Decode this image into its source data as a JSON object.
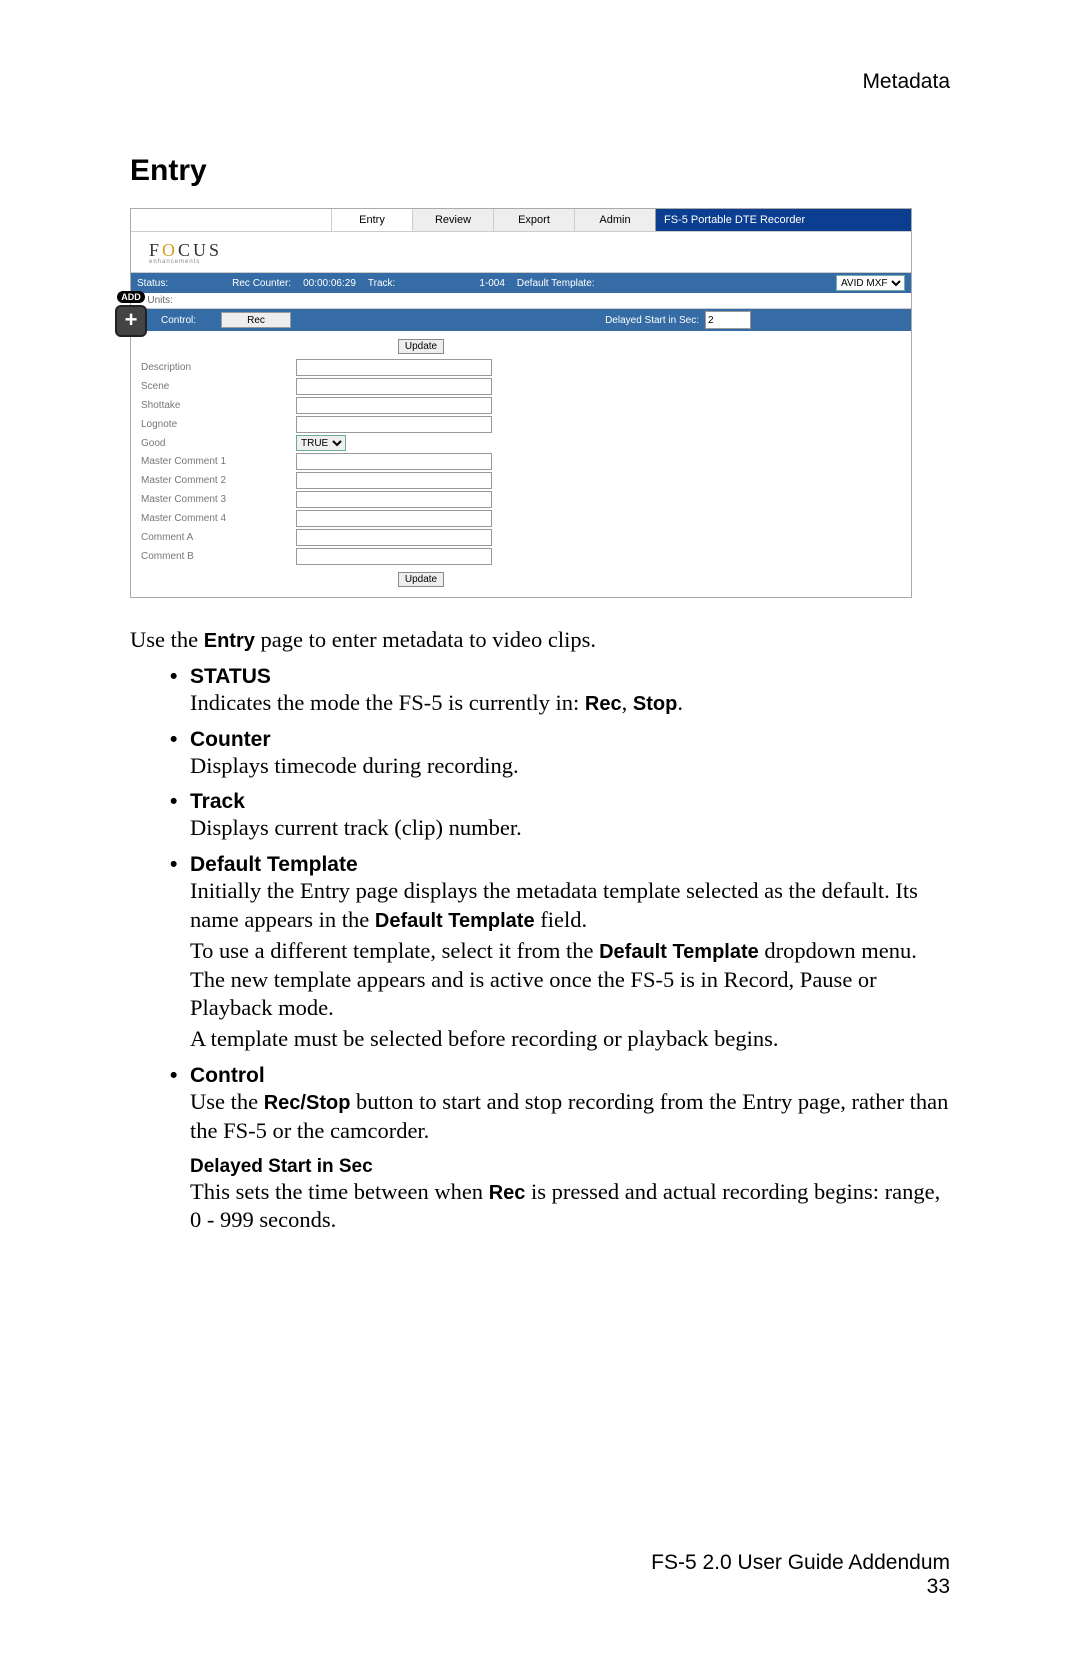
{
  "header": {
    "category": "Metadata"
  },
  "section": {
    "title": "Entry"
  },
  "screenshot": {
    "brand": {
      "pre": "F",
      "o": "O",
      "post": "CUS",
      "sub": "enhancements"
    },
    "tabs": [
      "Entry",
      "Review",
      "Export",
      "Admin"
    ],
    "titlebar": "FS-5 Portable DTE Recorder",
    "status": {
      "status_label": "Status:",
      "counter_label": "Rec  Counter:",
      "counter_value": "00:00:06:29",
      "track_label": "Track:",
      "track_value": "1-004",
      "template_label": "Default Template:",
      "template_value": "AVID MXF"
    },
    "units_label": "Units:",
    "add_label": "ADD",
    "control": {
      "label": "Control:",
      "button": "Rec",
      "delay_label": "Delayed Start in Sec:",
      "delay_value": "2"
    },
    "update_label": "Update",
    "fields": [
      {
        "label": "Description",
        "type": "text"
      },
      {
        "label": "Scene",
        "type": "text"
      },
      {
        "label": "Shottake",
        "type": "text"
      },
      {
        "label": "Lognote",
        "type": "text"
      },
      {
        "label": "Good",
        "type": "select",
        "value": "TRUE"
      },
      {
        "label": "Master Comment 1",
        "type": "text"
      },
      {
        "label": "Master Comment 2",
        "type": "text"
      },
      {
        "label": "Master Comment 3",
        "type": "text"
      },
      {
        "label": "Master Comment 4",
        "type": "text"
      },
      {
        "label": "Comment A",
        "type": "text"
      },
      {
        "label": "Comment B",
        "type": "text"
      }
    ]
  },
  "doc": {
    "intro_a": "Use the ",
    "intro_b": "Entry",
    "intro_c": " page to enter metadata to video clips.",
    "status_h": "STATUS",
    "status_t1": "Indicates the mode the FS-5 is currently in: ",
    "status_b1": "Rec",
    "status_sep": ", ",
    "status_b2": "Stop",
    "status_t2": ".",
    "counter_h": "Counter",
    "counter_t": "Displays timecode during recording.",
    "track_h": "Track",
    "track_t": "Displays current track (clip) number.",
    "dtmpl_h": "Default Template",
    "dtmpl_p1a": "Initially the Entry page displays the metadata template selected as the default. Its name appears in the ",
    "dtmpl_p1b": "Default Template",
    "dtmpl_p1c": " field.",
    "dtmpl_p2a": "To use a different template, select it from the ",
    "dtmpl_p2b": "Default Template",
    "dtmpl_p2c": " dropdown menu. The new template appears and is active once the FS-5 is in Record, Pause or Playback mode.",
    "dtmpl_p3": "A template must be selected before recording or playback begins.",
    "control_h": "Control",
    "control_p1a": "Use the ",
    "control_p1b": "Rec/Stop",
    "control_p1c": " button to start and stop recording from the Entry page, rather than the FS-5 or the camcorder.",
    "delay_h": "Delayed Start in Sec",
    "delay_p1a": "This sets the time between when ",
    "delay_p1b": "Rec",
    "delay_p1c": " is pressed and actual recording begins: range, 0 - 999 seconds."
  },
  "footer": {
    "line1": "FS-5 2.0 User Guide Addendum",
    "line2": "33"
  }
}
